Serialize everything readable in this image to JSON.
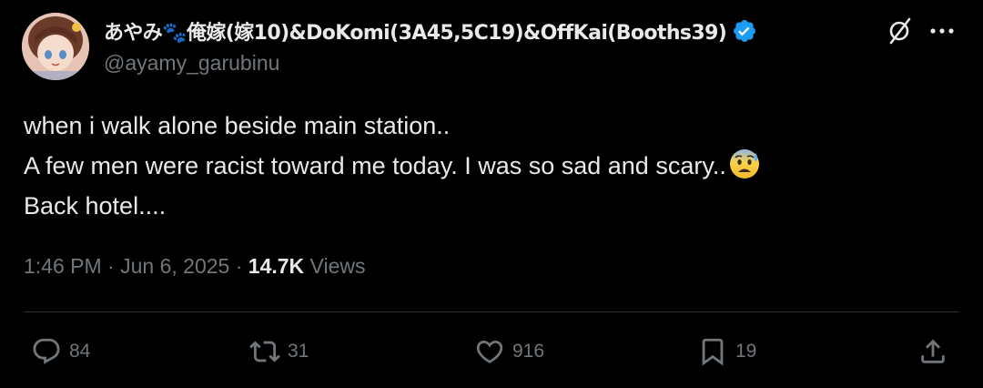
{
  "tweet": {
    "display_name": "あやみ🐾俺嫁(嫁10)&DoKomi(3A45,5C19)&OffKai(Booths39)",
    "handle": "@ayamy_garubinu",
    "text_lines": [
      "when i walk alone beside main station..",
      "A few men were racist toward me today. I was so sad and scary..",
      "Back hotel...."
    ],
    "emoji": "anxious-face-with-sweat-icon",
    "time": "1:46 PM",
    "date": "Jun 6, 2025",
    "views_count": "14.7K",
    "views_label": "Views",
    "separator": "·"
  },
  "actions": {
    "replies": "84",
    "reposts": "31",
    "likes": "916",
    "bookmarks": "19"
  },
  "colors": {
    "background": "#000000",
    "text": "#e7e9ea",
    "secondary": "#71767b",
    "verified": "#1d9bf0",
    "divider": "#2f3336"
  },
  "icons": [
    "avatar",
    "verified-icon",
    "grok-icon",
    "more-icon",
    "reply-icon",
    "repost-icon",
    "like-icon",
    "bookmark-icon",
    "share-icon"
  ]
}
